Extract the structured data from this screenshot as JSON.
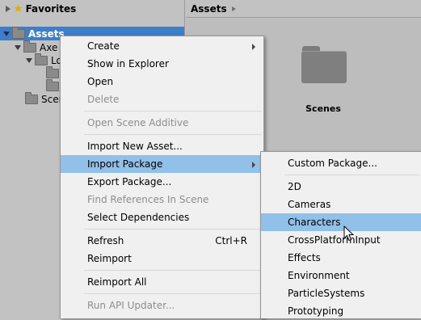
{
  "tree": {
    "favorites": "Favorites",
    "assets": "Assets",
    "child_1": "Axe",
    "child_2": "Lo",
    "child_3": "Scen"
  },
  "assets_panel": {
    "breadcrumb": "Assets",
    "folder_label": "Scenes"
  },
  "context_menu": {
    "create": "Create",
    "show_in_explorer": "Show in Explorer",
    "open": "Open",
    "delete": "Delete",
    "open_scene_additive": "Open Scene Additive",
    "import_new_asset": "Import New Asset...",
    "import_package": "Import Package",
    "export_package": "Export Package...",
    "find_references": "Find References In Scene",
    "select_dependencies": "Select Dependencies",
    "refresh": "Refresh",
    "refresh_shortcut": "Ctrl+R",
    "reimport": "Reimport",
    "reimport_all": "Reimport All",
    "run_api_updater": "Run API Updater..."
  },
  "import_package_menu": {
    "custom_package": "Custom Package...",
    "items": [
      "2D",
      "Cameras",
      "Characters",
      "CrossPlatformInput",
      "Effects",
      "Environment",
      "ParticleSystems",
      "Prototyping"
    ]
  },
  "colors": {
    "selection": "#3e7ec9",
    "menu_highlight": "#91c0e8",
    "panel_bg": "#c2c2c2"
  }
}
